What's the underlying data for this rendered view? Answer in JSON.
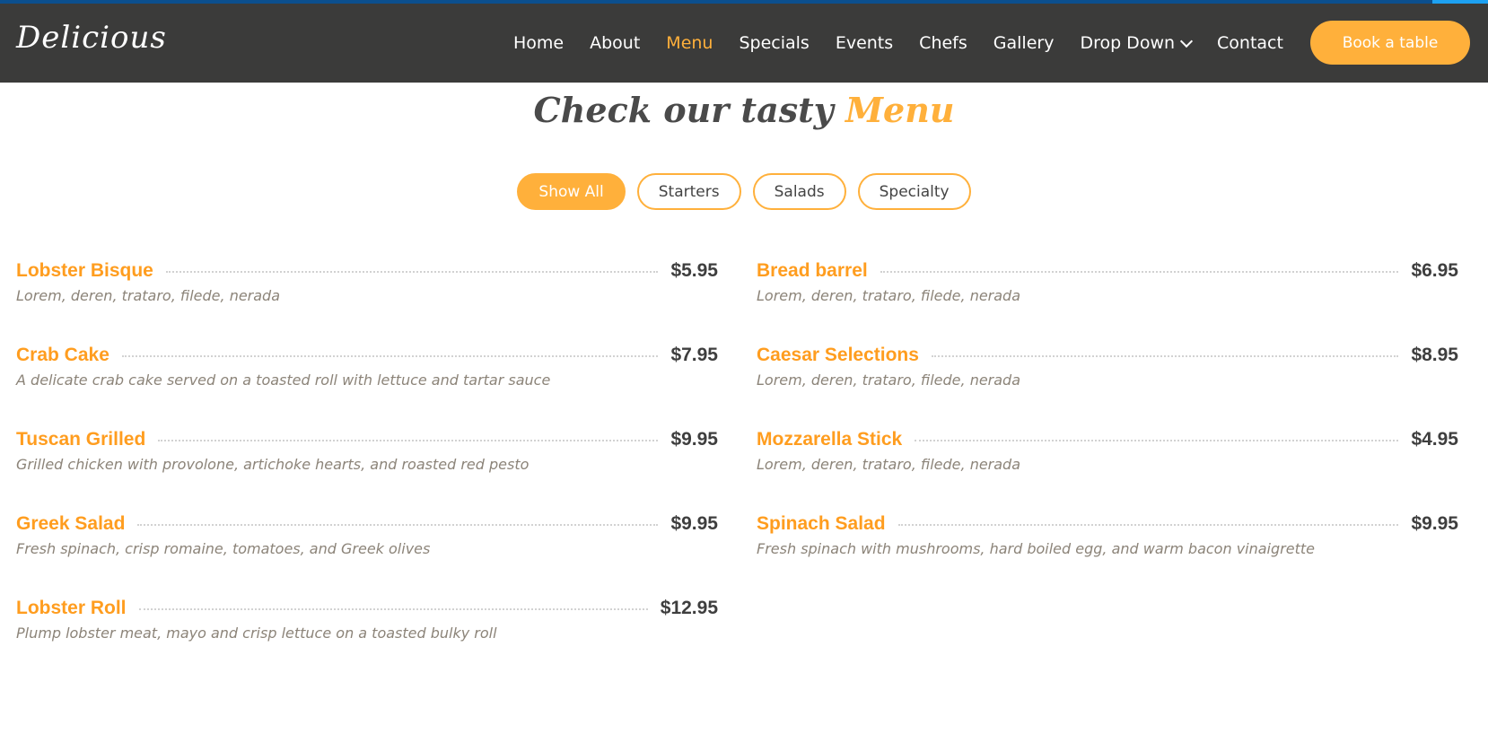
{
  "site": {
    "logo": "Delicious"
  },
  "nav": {
    "items": [
      {
        "label": "Home"
      },
      {
        "label": "About"
      },
      {
        "label": "Menu"
      },
      {
        "label": "Specials"
      },
      {
        "label": "Events"
      },
      {
        "label": "Chefs"
      },
      {
        "label": "Gallery"
      },
      {
        "label": "Drop Down"
      },
      {
        "label": "Contact"
      }
    ],
    "active": "Menu",
    "book_label": "Book a table"
  },
  "section": {
    "title_prefix": "Check our tasty",
    "title_accent": "Menu"
  },
  "filters": [
    {
      "label": "Show All"
    },
    {
      "label": "Starters"
    },
    {
      "label": "Salads"
    },
    {
      "label": "Specialty"
    }
  ],
  "active_filter": "Show All",
  "menu": {
    "left": [
      {
        "name": "Lobster Bisque",
        "price": "$5.95",
        "desc": "Lorem, deren, trataro, filede, nerada"
      },
      {
        "name": "Crab Cake",
        "price": "$7.95",
        "desc": "A delicate crab cake served on a toasted roll with lettuce and tartar sauce"
      },
      {
        "name": "Tuscan Grilled",
        "price": "$9.95",
        "desc": "Grilled chicken with provolone, artichoke hearts, and roasted red pesto"
      },
      {
        "name": "Greek Salad",
        "price": "$9.95",
        "desc": "Fresh spinach, crisp romaine, tomatoes, and Greek olives"
      },
      {
        "name": "Lobster Roll",
        "price": "$12.95",
        "desc": "Plump lobster meat, mayo and crisp lettuce on a toasted bulky roll"
      }
    ],
    "right": [
      {
        "name": "Bread barrel",
        "price": "$6.95",
        "desc": "Lorem, deren, trataro, filede, nerada"
      },
      {
        "name": "Caesar Selections",
        "price": "$8.95",
        "desc": "Lorem, deren, trataro, filede, nerada"
      },
      {
        "name": "Mozzarella Stick",
        "price": "$4.95",
        "desc": "Lorem, deren, trataro, filede, nerada"
      },
      {
        "name": "Spinach Salad",
        "price": "$9.95",
        "desc": "Fresh spinach with mushrooms, hard boiled egg, and warm bacon vinaigrette"
      }
    ]
  },
  "colors": {
    "accent": "#ffb03b",
    "item_name": "#ff9d1f",
    "header_bg": "#3b3b3a"
  },
  "icons": {
    "dropdown": "chevron-down-icon"
  }
}
